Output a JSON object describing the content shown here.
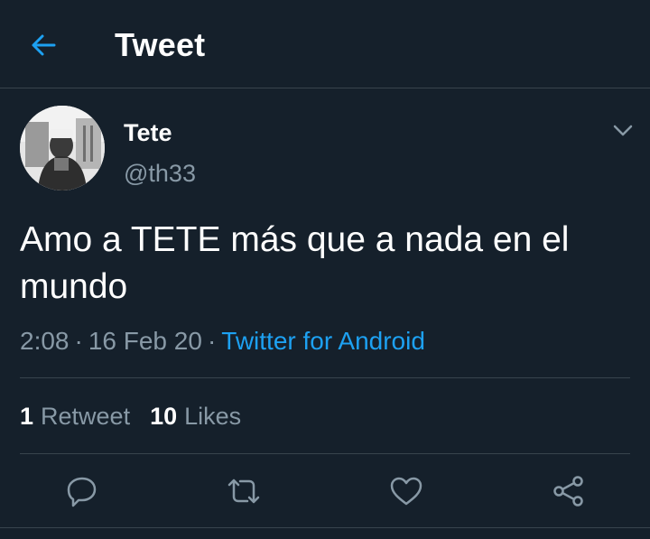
{
  "header": {
    "title": "Tweet"
  },
  "tweet": {
    "author": {
      "name": "Tete",
      "handle": "@th33"
    },
    "text": "Amo a TETE más que a nada en el mundo",
    "time": "2:08",
    "date": "16 Feb 20",
    "source": "Twitter for Android",
    "separator": "·"
  },
  "stats": {
    "retweets": {
      "count": "1",
      "label": "Retweet"
    },
    "likes": {
      "count": "10",
      "label": "Likes"
    }
  },
  "actions": [
    "reply-icon",
    "retweet-icon",
    "like-icon",
    "share-icon"
  ],
  "colors": {
    "background": "#15202b",
    "accent": "#1da1f2",
    "muted": "#8899a6",
    "divider": "#38444d"
  }
}
